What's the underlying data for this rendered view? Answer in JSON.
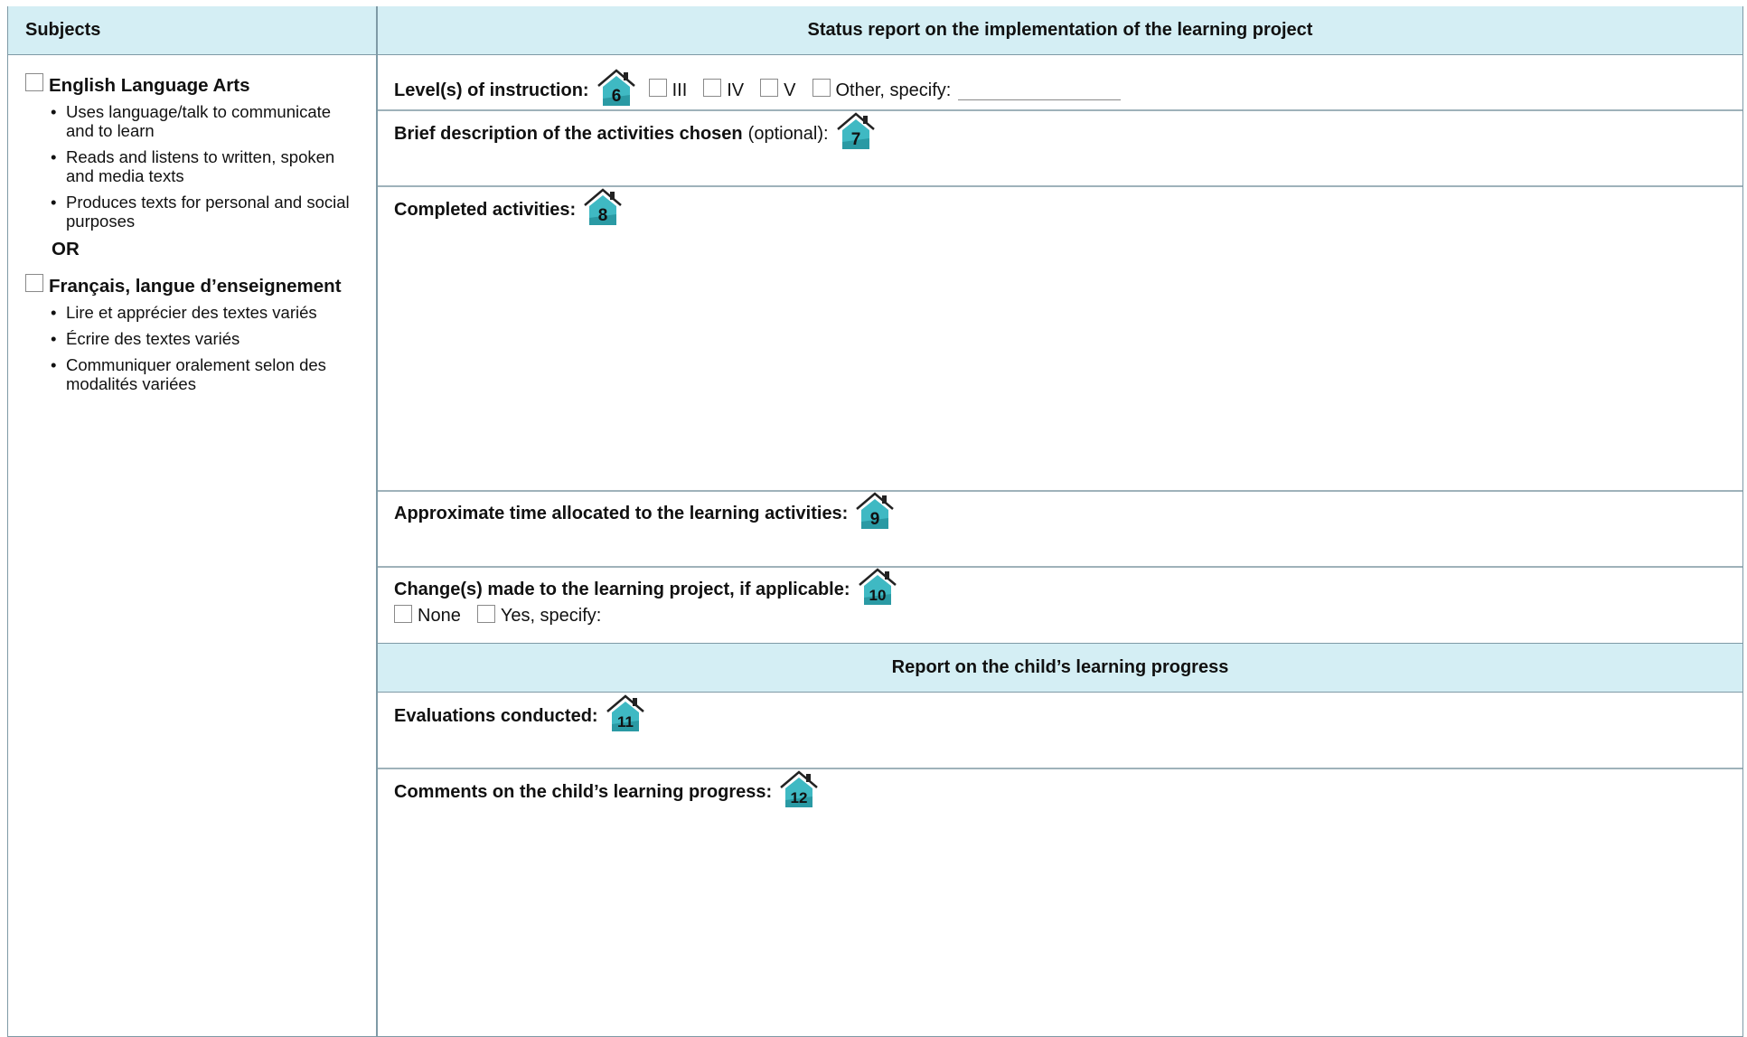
{
  "header": {
    "subjects": "Subjects",
    "status_title": "Status report on the implementation of the learning project"
  },
  "subjects": [
    {
      "title": "English Language Arts",
      "items": [
        "Uses language/talk to communicate and to learn",
        "Reads and listens to written, spoken and media texts",
        "Produces texts for personal and social purposes"
      ]
    },
    {
      "title": "Français, langue d’enseignement",
      "items": [
        "Lire et apprécier des textes variés",
        "Écrire des textes variés",
        "Communiquer oralement selon des modalités variées"
      ]
    }
  ],
  "or_label": "OR",
  "sections": {
    "levels": {
      "label": "Level(s) of instruction:",
      "badge": "6",
      "options": [
        "III",
        "IV",
        "V"
      ],
      "other": "Other, specify:"
    },
    "description": {
      "label": "Brief description of the activities chosen",
      "optional": "(optional):",
      "badge": "7"
    },
    "completed": {
      "label": "Completed activities:",
      "badge": "8"
    },
    "time": {
      "label": "Approximate time allocated to the learning activities:",
      "badge": "9"
    },
    "changes": {
      "label": "Change(s) made to the learning project, if applicable:",
      "badge": "10",
      "none": "None",
      "yes": "Yes, specify:"
    },
    "report_header": "Report on the child’s learning progress",
    "evaluations": {
      "label": "Evaluations conducted:",
      "badge": "11"
    },
    "comments": {
      "label": "Comments on the child’s learning progress:",
      "badge": "12"
    }
  },
  "colors": {
    "header_bg": "#d4eef4",
    "badge_teal": "#3fb9c3",
    "border": "#7f9aa6"
  },
  "icons": {
    "badge": "house-icon",
    "checkbox": "checkbox-icon"
  }
}
